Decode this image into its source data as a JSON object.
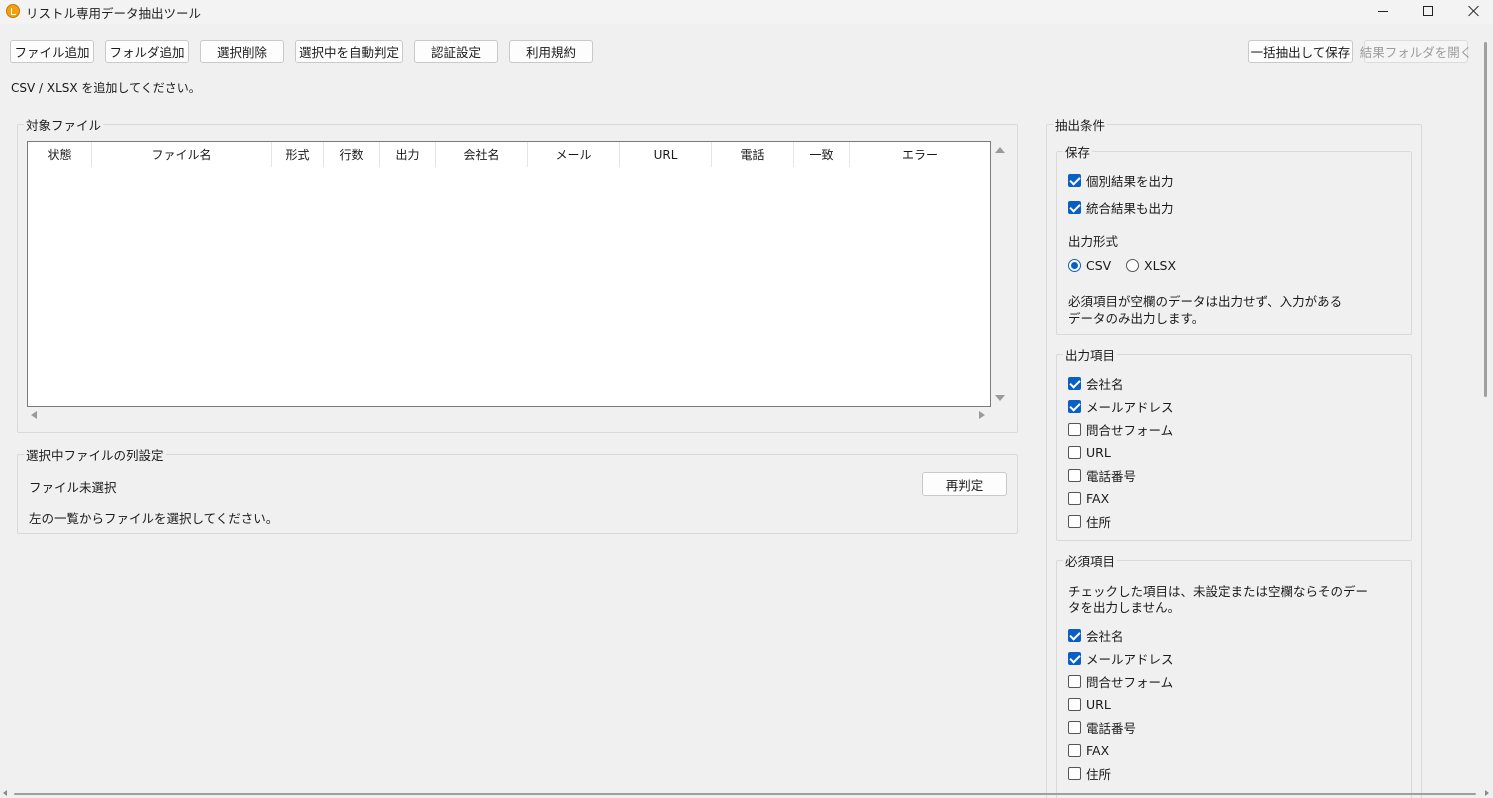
{
  "window": {
    "title": "リストル専用データ抽出ツール"
  },
  "toolbar": {
    "add_file": "ファイル追加",
    "add_folder": "フォルダ追加",
    "remove_selected": "選択削除",
    "auto_detect": "選択中を自動判定",
    "auth_settings": "認証設定",
    "terms": "利用規約",
    "batch_extract": "一括抽出して保存",
    "open_result_folder": "結果フォルダを開く"
  },
  "hint": "CSV / XLSX を追加してください。",
  "target_files": {
    "legend": "対象ファイル",
    "columns": [
      "状態",
      "ファイル名",
      "形式",
      "行数",
      "出力",
      "会社名",
      "メール",
      "URL",
      "電話",
      "一致",
      "エラー"
    ]
  },
  "column_settings": {
    "legend": "選択中ファイルの列設定",
    "status": "ファイル未選択",
    "rejudge": "再判定",
    "instruction": "左の一覧からファイルを選択してください。"
  },
  "conditions": {
    "legend": "抽出条件",
    "save": {
      "legend": "保存",
      "individual": {
        "label": "個別結果を出力",
        "checked": true
      },
      "combined": {
        "label": "統合結果も出力",
        "checked": true
      },
      "format_label": "出力形式",
      "formats": [
        {
          "label": "CSV",
          "selected": true
        },
        {
          "label": "XLSX",
          "selected": false
        }
      ],
      "note_line1": "必須項目が空欄のデータは出力せず、入力がある",
      "note_line2": "データのみ出力します。"
    },
    "output_items": {
      "legend": "出力項目",
      "items": [
        {
          "label": "会社名",
          "checked": true
        },
        {
          "label": "メールアドレス",
          "checked": true
        },
        {
          "label": "問合せフォーム",
          "checked": false
        },
        {
          "label": "URL",
          "checked": false
        },
        {
          "label": "電話番号",
          "checked": false
        },
        {
          "label": "FAX",
          "checked": false
        },
        {
          "label": "住所",
          "checked": false
        }
      ]
    },
    "required_items": {
      "legend": "必須項目",
      "note_line1": "チェックした項目は、未設定または空欄ならそのデー",
      "note_line2": "タを出力しません。",
      "items": [
        {
          "label": "会社名",
          "checked": true
        },
        {
          "label": "メールアドレス",
          "checked": true
        },
        {
          "label": "問合せフォーム",
          "checked": false
        },
        {
          "label": "URL",
          "checked": false
        },
        {
          "label": "電話番号",
          "checked": false
        },
        {
          "label": "FAX",
          "checked": false
        },
        {
          "label": "住所",
          "checked": false
        }
      ]
    }
  }
}
